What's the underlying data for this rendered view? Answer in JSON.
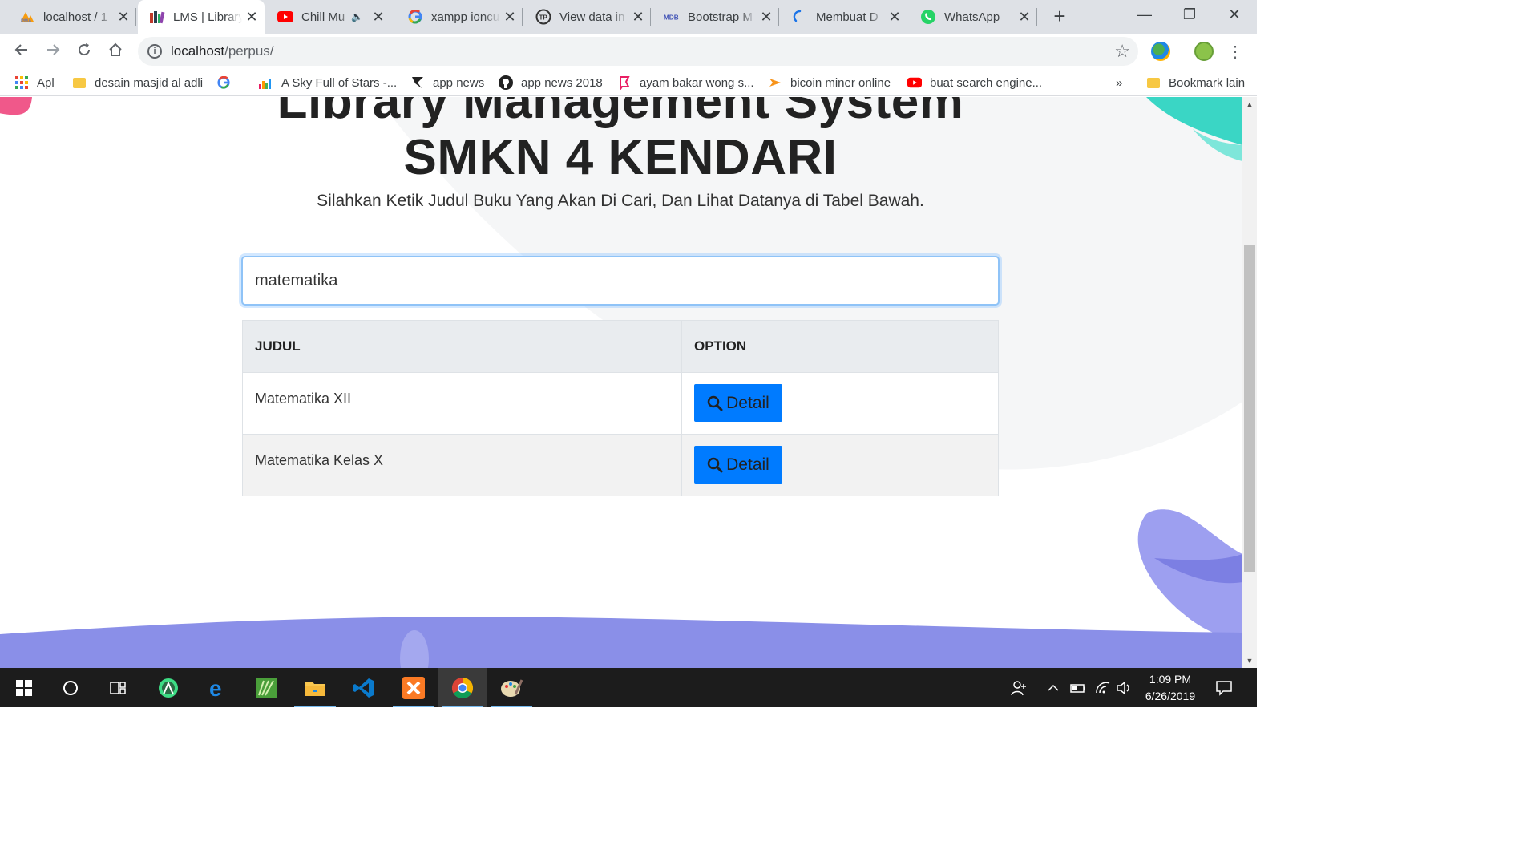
{
  "browser": {
    "tabs": [
      {
        "title": "localhost / 1",
        "active": false,
        "muted": false
      },
      {
        "title": "LMS | Library",
        "active": true,
        "muted": false
      },
      {
        "title": "Chill Mu",
        "active": false,
        "muted": true
      },
      {
        "title": "xampp ioncu",
        "active": false,
        "muted": false
      },
      {
        "title": "View data in",
        "active": false,
        "muted": false
      },
      {
        "title": "Bootstrap M",
        "active": false,
        "muted": false
      },
      {
        "title": "Membuat D",
        "active": false,
        "muted": false
      },
      {
        "title": "WhatsApp",
        "active": false,
        "muted": false
      }
    ],
    "url_host": "localhost",
    "url_path": "/perpus/",
    "bookmarks": [
      {
        "label": "Apl",
        "icon": "apps-grid-icon"
      },
      {
        "label": "desain masjid al adli",
        "icon": "folder-icon"
      },
      {
        "label": "",
        "icon": "google-icon"
      },
      {
        "label": "A Sky Full of Stars -...",
        "icon": "equalizer-icon"
      },
      {
        "label": "app news",
        "icon": "app-news-icon"
      },
      {
        "label": "app news 2018",
        "icon": "github-icon"
      },
      {
        "label": "ayam bakar wong s...",
        "icon": "bookmark-icon"
      },
      {
        "label": "bicoin miner online",
        "icon": "bitcoin-icon"
      },
      {
        "label": "buat search engine...",
        "icon": "youtube-icon"
      }
    ],
    "bookmarks_overflow": "»",
    "other_bookmarks": "Bookmark lain"
  },
  "page": {
    "title_line1": "Library Management System",
    "title_line2": "SMKN 4 KENDARI",
    "subtitle": "Silahkan Ketik Judul Buku Yang Akan Di Cari, Dan Lihat Datanya di Tabel Bawah.",
    "search_value": "matematika",
    "table": {
      "headers": [
        "JUDUL",
        "OPTION"
      ],
      "rows": [
        {
          "judul": "Matematika XII",
          "button": "Detail"
        },
        {
          "judul": "Matematika Kelas X",
          "button": "Detail"
        }
      ]
    },
    "colors": {
      "primary": "#007bff",
      "wave": "#8a8fe8",
      "accent_teal": "#3ad6c5",
      "accent_pink": "#f0588a"
    }
  },
  "taskbar": {
    "apps": [
      "windows-start-icon",
      "cortana-icon",
      "task-view-icon",
      "android-studio-icon",
      "edge-icon",
      "sublime-icon",
      "file-explorer-icon",
      "vscode-icon",
      "xampp-icon",
      "chrome-icon",
      "paint-icon"
    ],
    "time": "1:09 PM",
    "date": "6/26/2019"
  }
}
